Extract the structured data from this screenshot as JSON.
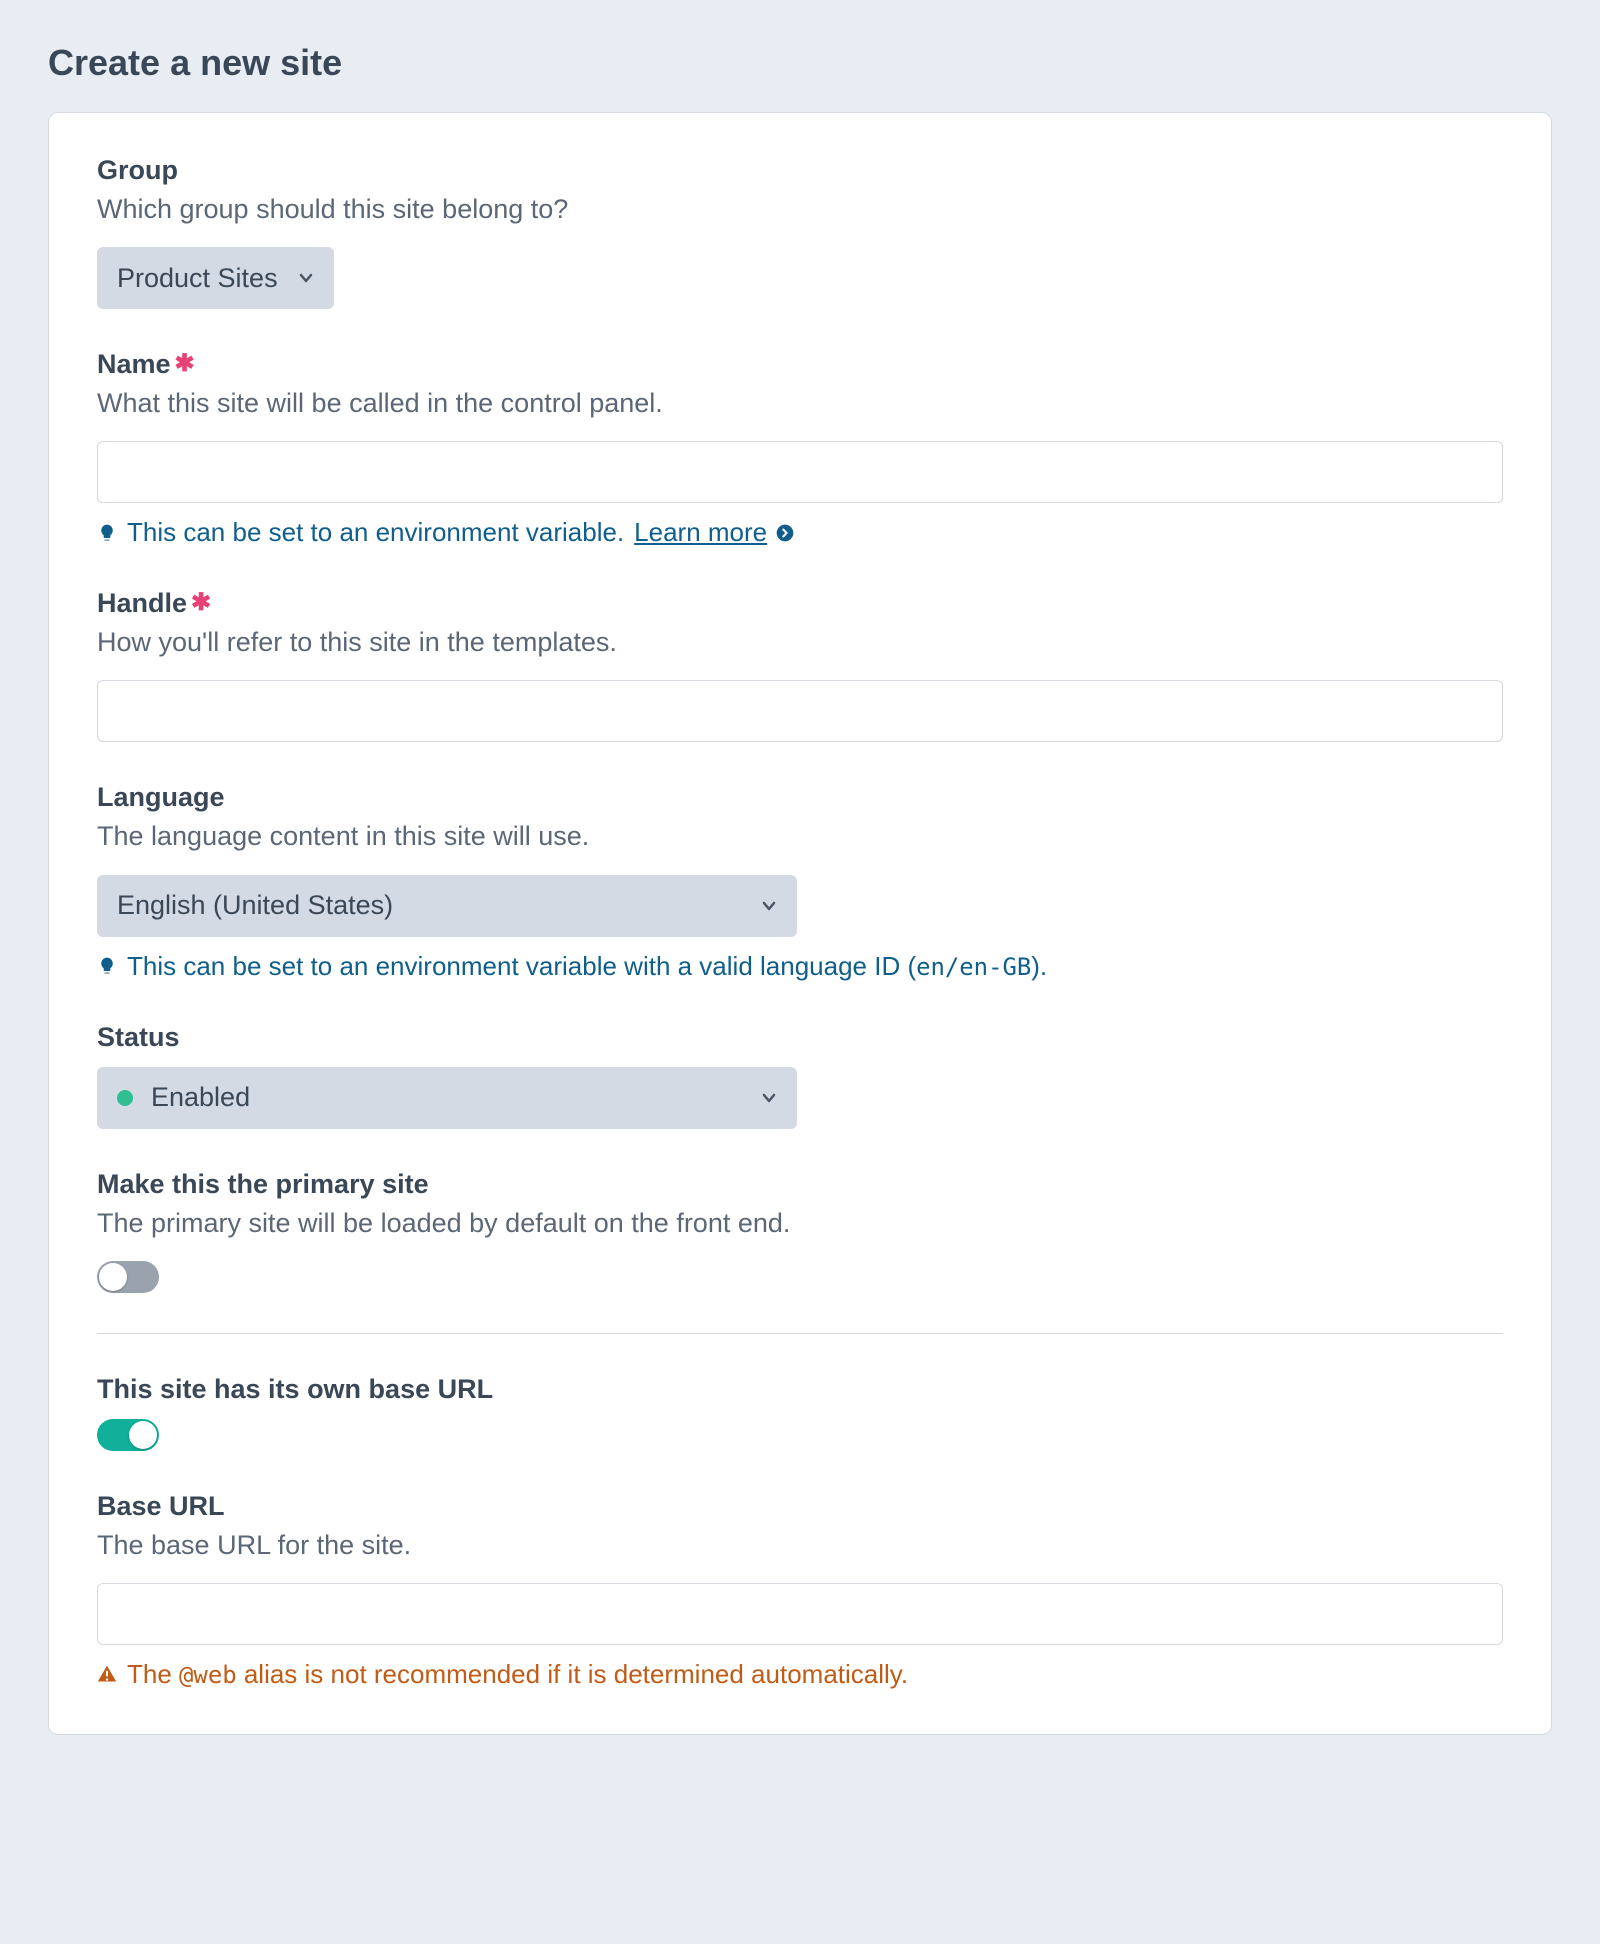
{
  "page": {
    "title": "Create a new site"
  },
  "fields": {
    "group": {
      "label": "Group",
      "instructions": "Which group should this site belong to?",
      "selected": "Product Sites"
    },
    "name": {
      "label": "Name",
      "instructions": "What this site will be called in the control panel.",
      "value": "",
      "tip": "This can be set to an environment variable.",
      "tip_link_label": "Learn more"
    },
    "handle": {
      "label": "Handle",
      "instructions": "How you'll refer to this site in the templates.",
      "value": ""
    },
    "language": {
      "label": "Language",
      "instructions": "The language content in this site will use.",
      "selected": "English (United States)",
      "tip_prefix": "This can be set to an environment variable with a valid language ID (",
      "tip_code": "en/en-GB",
      "tip_suffix": ")."
    },
    "status": {
      "label": "Status",
      "selected": "Enabled"
    },
    "primary": {
      "label": "Make this the primary site",
      "instructions": "The primary site will be loaded by default on the front end.",
      "on": false
    },
    "hasBaseUrl": {
      "label": "This site has its own base URL",
      "on": true
    },
    "baseUrl": {
      "label": "Base URL",
      "instructions": "The base URL for the site.",
      "value": "",
      "warn_prefix": "The ",
      "warn_code": "@web",
      "warn_suffix": " alias is not recommended if it is determined automatically."
    }
  }
}
